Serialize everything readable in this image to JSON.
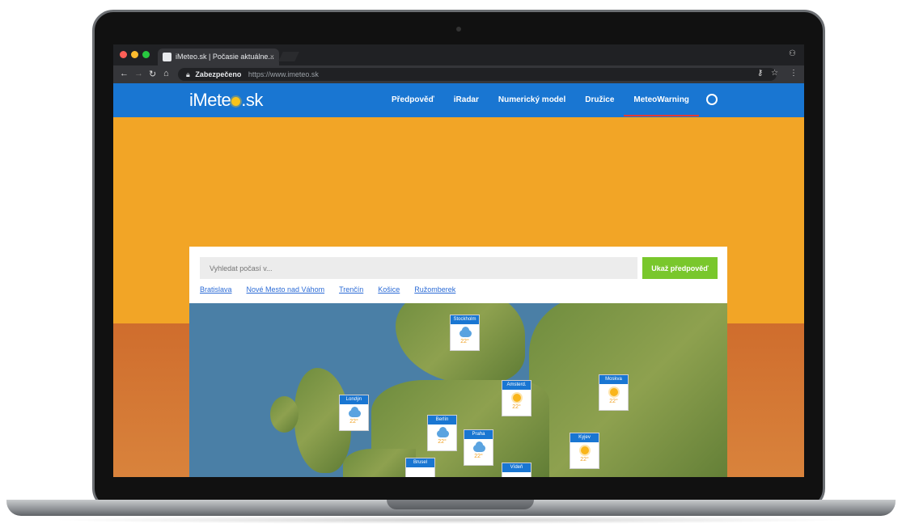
{
  "browser": {
    "tab_title": "iMeteo.sk | Počasie aktuálne...",
    "tab_close": "×",
    "secure_label": "Zabezpečeno",
    "url": "https://www.imeteo.sk"
  },
  "site": {
    "logo_text_left": "iMete",
    "logo_text_right": ".sk",
    "nav": [
      "Předpověď",
      "iRadar",
      "Numerický model",
      "Družice",
      "MeteoWarning"
    ],
    "active_nav": "MeteoWarning"
  },
  "search": {
    "placeholder": "Vyhledat počasí v...",
    "button_label": "Ukaž předpověď",
    "quick_links": [
      "Bratislava",
      "Nové Mesto nad Váhom",
      "Trenčín",
      "Košice",
      "Ružomberek"
    ]
  },
  "map": {
    "cities": [
      {
        "name": "Stockholm",
        "temp": "22°",
        "icon": "cloud-icon"
      },
      {
        "name": "Londýn",
        "temp": "22°",
        "icon": "cloud-icon"
      },
      {
        "name": "Amsterd.",
        "temp": "22°",
        "icon": "sun-icon"
      },
      {
        "name": "Moskva",
        "temp": "22°",
        "icon": "sun-icon"
      },
      {
        "name": "Berlín",
        "temp": "22°",
        "icon": "cloud-icon"
      },
      {
        "name": "Praha",
        "temp": "22°",
        "icon": "cloud-icon"
      },
      {
        "name": "Kyjev",
        "temp": "22°",
        "icon": "sun-icon"
      },
      {
        "name": "Brusel",
        "temp": "",
        "icon": ""
      },
      {
        "name": "Vídeň",
        "temp": "",
        "icon": ""
      }
    ]
  },
  "colors": {
    "nav_blue": "#1976d2",
    "hero_orange": "#f2a526",
    "button_green": "#79c72c",
    "link_blue": "#2b6bd6"
  }
}
